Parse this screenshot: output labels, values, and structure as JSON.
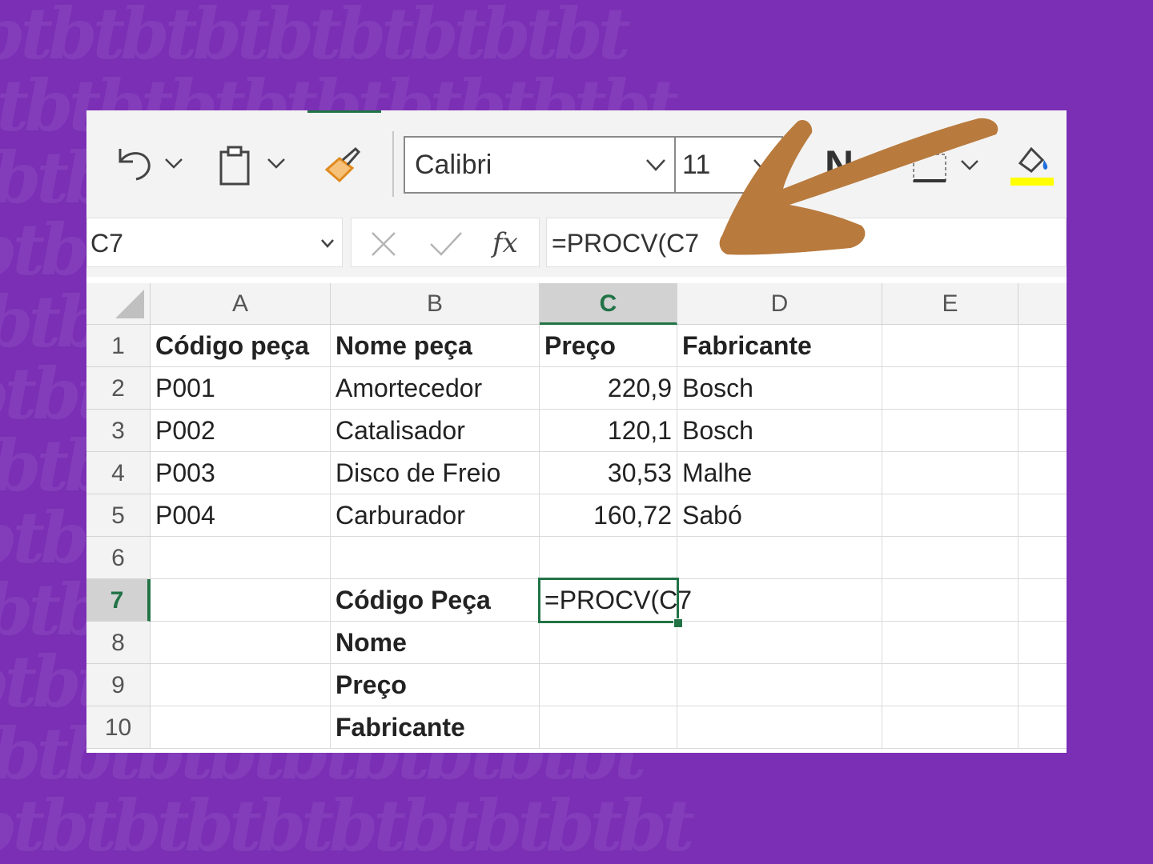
{
  "ribbon": {
    "font_name": "Calibri",
    "font_size": "11",
    "bold_label": "N",
    "icons": [
      "undo-icon",
      "paste-icon",
      "format-painter-icon",
      "borders-icon",
      "fill-color-icon"
    ],
    "fill_color": "#ffff00"
  },
  "formula_bar": {
    "name_box": "C7",
    "fx_label": "fx",
    "formula": "=PROCV(C7"
  },
  "sheet": {
    "columns": [
      "A",
      "B",
      "C",
      "D",
      "E"
    ],
    "active_column": "C",
    "active_row": "7",
    "rows": [
      {
        "num": "1",
        "a": "Código peça",
        "b": "Nome peça",
        "c": "Preço",
        "d": "Fabricante"
      },
      {
        "num": "2",
        "a": "P001",
        "b": "Amortecedor",
        "c": "220,9",
        "d": "Bosch"
      },
      {
        "num": "3",
        "a": "P002",
        "b": "Catalisador",
        "c": "120,1",
        "d": "Bosch"
      },
      {
        "num": "4",
        "a": "P003",
        "b": "Disco de Freio",
        "c": "30,53",
        "d": "Malhe"
      },
      {
        "num": "5",
        "a": "P004",
        "b": "Carburador",
        "c": "160,72",
        "d": "Sabó"
      },
      {
        "num": "6",
        "a": "",
        "b": "",
        "c": "",
        "d": ""
      },
      {
        "num": "7",
        "a": "",
        "b": "Código Peça",
        "c": "=PROCV(C7",
        "d": ""
      },
      {
        "num": "8",
        "a": "",
        "b": "Nome",
        "c": "",
        "d": ""
      },
      {
        "num": "9",
        "a": "",
        "b": "Preço",
        "c": "",
        "d": ""
      },
      {
        "num": "10",
        "a": "",
        "b": "Fabricante",
        "c": "",
        "d": ""
      }
    ]
  },
  "colors": {
    "background": "#7b2fb5",
    "excel_green": "#217346",
    "arrow": "#b87a3d"
  }
}
